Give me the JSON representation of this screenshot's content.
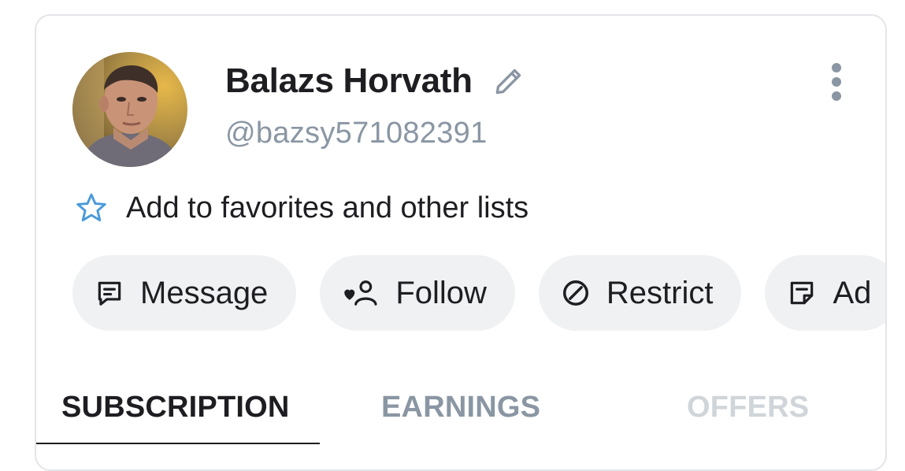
{
  "profile": {
    "name": "Balazs Horvath",
    "handle": "@bazsy571082391",
    "avatar_icon": "user-avatar-photo",
    "edit_icon": "pencil-icon",
    "more_icon": "more-vertical-icon"
  },
  "favorites": {
    "label": "Add to favorites and other lists",
    "icon": "star-outline-icon",
    "icon_color": "#4a9ad9"
  },
  "actions": [
    {
      "label": "Message",
      "icon": "message-icon"
    },
    {
      "label": "Follow",
      "icon": "follow-heart-user-icon"
    },
    {
      "label": "Restrict",
      "icon": "restrict-icon"
    },
    {
      "label": "Ad",
      "icon": "note-icon"
    }
  ],
  "tabs": [
    {
      "label": "SUBSCRIPTION",
      "active": true
    },
    {
      "label": "EARNINGS",
      "active": false
    },
    {
      "label": "OFFERS",
      "active": false,
      "disabled": true
    }
  ],
  "colors": {
    "text_primary": "#1e1e22",
    "text_secondary": "#8a96a3",
    "pill_bg": "#eff1f3",
    "card_border": "#e3e5e9",
    "accent_star": "#4a9ad9"
  }
}
